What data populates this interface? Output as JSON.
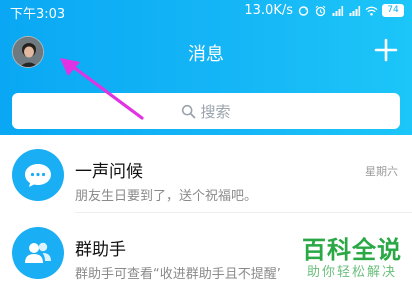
{
  "status_bar": {
    "time": "下午3:03",
    "network_speed": "13.0K/s",
    "battery": "74",
    "icons": [
      "sync-icon",
      "alarm-icon",
      "signal-icon",
      "signal-icon",
      "wifi-icon",
      "battery-icon"
    ]
  },
  "header": {
    "title": "消息",
    "avatar_icon": "profile-photo",
    "add_icon": "plus-icon",
    "accent_color": "#12b0f5"
  },
  "annotation": {
    "icon": "magenta-arrow",
    "color": "#e233e2"
  },
  "search": {
    "placeholder": "搜索"
  },
  "conversations": [
    {
      "title": "一声问候",
      "preview": "朋友生日要到了，送个祝福吧。",
      "time": "星期六",
      "icon": "chat-bubble-icon"
    },
    {
      "title": "群助手",
      "preview": "群助手可查看“收进群助手且不提醒”的群消息",
      "time": "",
      "icon": "group-users-icon"
    }
  ],
  "watermark": {
    "main": "百科全说",
    "sub": "助你轻松解决"
  }
}
